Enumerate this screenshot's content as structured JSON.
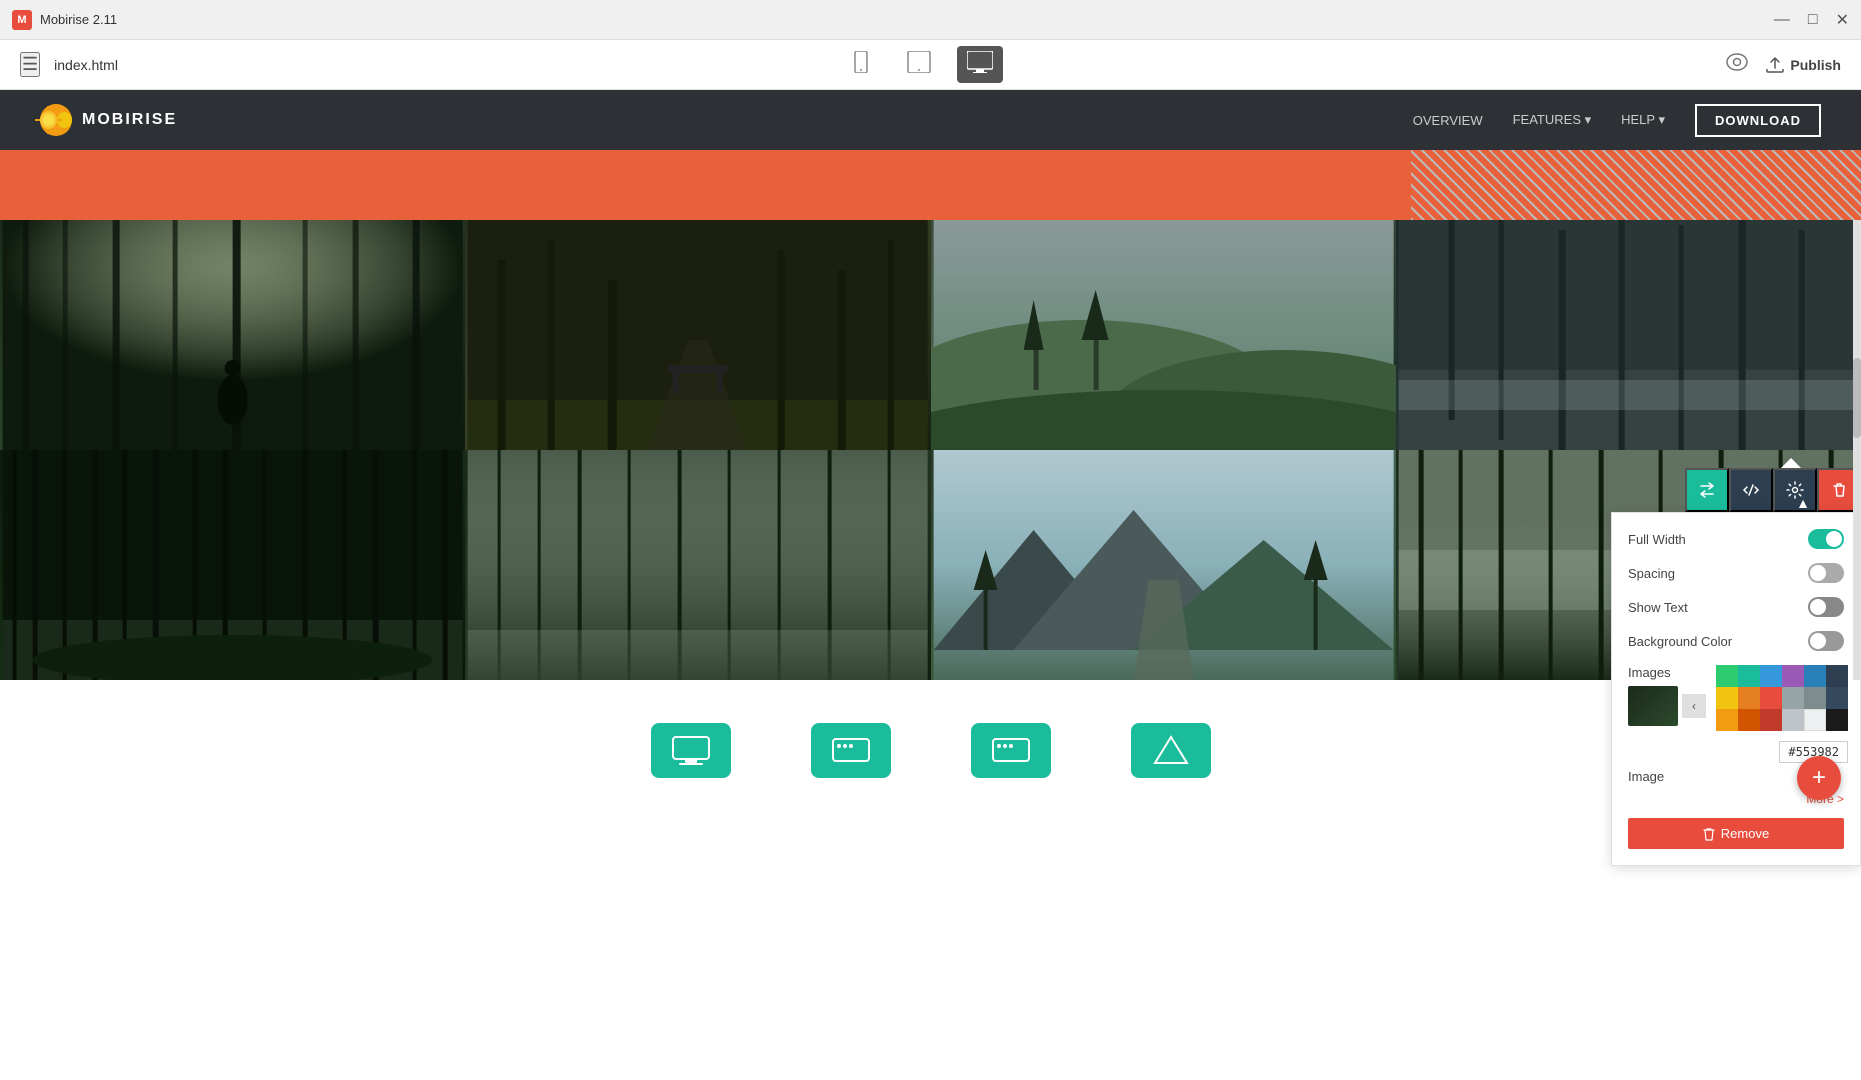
{
  "titlebar": {
    "logo_text": "M",
    "title": "Mobirise 2.11",
    "minimize": "—",
    "maximize": "□",
    "close": "✕"
  },
  "toolbar": {
    "hamburger": "☰",
    "file_name": "index.html",
    "device_mobile": "📱",
    "device_tablet": "📱",
    "device_desktop": "🖥",
    "preview_icon": "👁",
    "publish_label": "Publish",
    "publish_icon": "☁"
  },
  "navbar": {
    "brand_name": "MOBIRISE",
    "links": [
      {
        "label": "OVERVIEW"
      },
      {
        "label": "FEATURES ▾"
      },
      {
        "label": "HELP ▾"
      },
      {
        "label": "DOWNLOAD"
      }
    ]
  },
  "settings_panel": {
    "title": "",
    "rows": [
      {
        "label": "Full Width",
        "toggle_state": "on"
      },
      {
        "label": "Spacing",
        "toggle_state": "off"
      },
      {
        "label": "Show Text",
        "toggle_state": "dark"
      },
      {
        "label": "Background Color",
        "toggle_state": "dark"
      }
    ],
    "images_label": "Images",
    "image_label": "Image",
    "more_label": "More >",
    "remove_label": "Remove",
    "hex_value": "#553982",
    "palette": {
      "row1": [
        "#2ecc71",
        "#1abc9c",
        "#3498db",
        "#9b59b6",
        "#2980b9",
        "#2c3e50"
      ],
      "row2": [
        "#f1c40f",
        "#e67e22",
        "#e74c3c",
        "#95a5a6",
        "#7f8c8d",
        "#34495e"
      ],
      "row3": [
        "#f39c12",
        "#d35400",
        "#c0392b",
        "#bdc3c7",
        "#ecf0f1",
        "#1a1a1a"
      ]
    }
  },
  "panel_tools": {
    "swap": "⇅",
    "code": "</>",
    "gear": "⚙",
    "delete": "🗑"
  },
  "fab": {
    "label": "+"
  },
  "gallery_cells": [
    {
      "id": 1,
      "alt": "Forest sunlight"
    },
    {
      "id": 2,
      "alt": "Forest path boardwalk"
    },
    {
      "id": 3,
      "alt": "Misty green hills"
    },
    {
      "id": 4,
      "alt": "Foggy forest"
    },
    {
      "id": 5,
      "alt": "Dense forest floor"
    },
    {
      "id": 6,
      "alt": "Misty tall trees"
    },
    {
      "id": 7,
      "alt": "Mountain road scenery"
    },
    {
      "id": 8,
      "alt": "Foggy forest trees"
    }
  ]
}
